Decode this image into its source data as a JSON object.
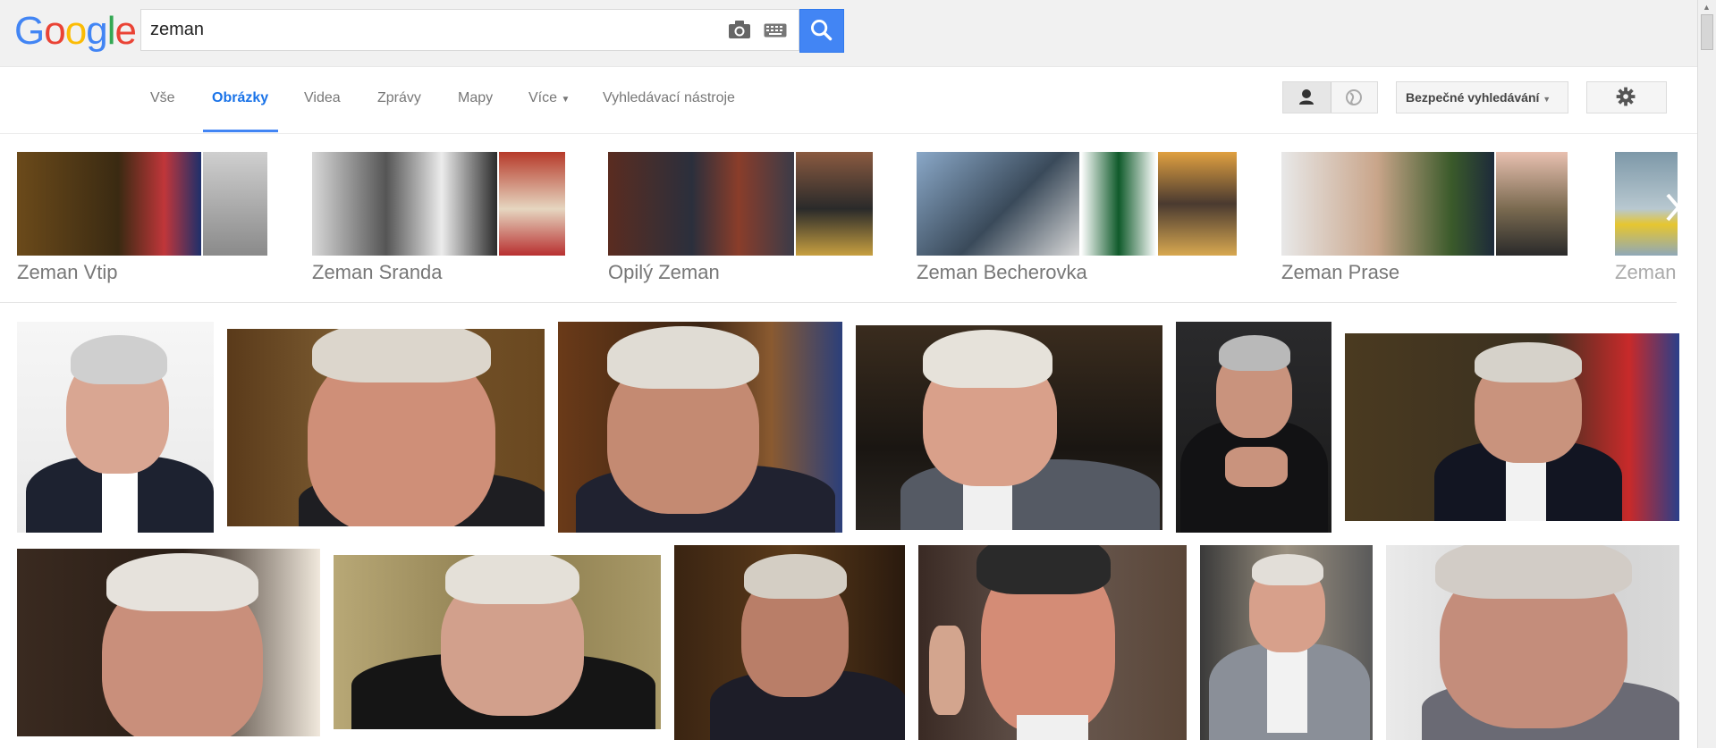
{
  "logo": {
    "letters": [
      "G",
      "o",
      "o",
      "g",
      "l",
      "e"
    ],
    "colors": [
      "#4285f4",
      "#ea4335",
      "#fbbc05",
      "#4285f4",
      "#34a853",
      "#ea4335"
    ]
  },
  "search": {
    "query": "zeman",
    "icons": [
      "camera-icon",
      "keyboard-icon",
      "search-icon"
    ]
  },
  "tabs": [
    {
      "label": "Vše"
    },
    {
      "label": "Obrázky",
      "active": true
    },
    {
      "label": "Videa"
    },
    {
      "label": "Zprávy"
    },
    {
      "label": "Mapy"
    },
    {
      "label": "Více"
    },
    {
      "label": "Vyhledávací nástroje"
    }
  ],
  "right_controls": {
    "safe_search_label": "Bezpečné vyhledávání",
    "icons": [
      "person-icon",
      "globe-icon",
      "gear-icon"
    ]
  },
  "related": [
    {
      "label": "Zeman Vtip"
    },
    {
      "label": "Zeman Sranda"
    },
    {
      "label": "Opilý Zeman"
    },
    {
      "label": "Zeman Becherovka"
    },
    {
      "label": "Zeman Prase"
    },
    {
      "label": "Zeman r"
    }
  ],
  "colors": {
    "accent": "#4285f4",
    "topbar": "#f1f1f1"
  }
}
